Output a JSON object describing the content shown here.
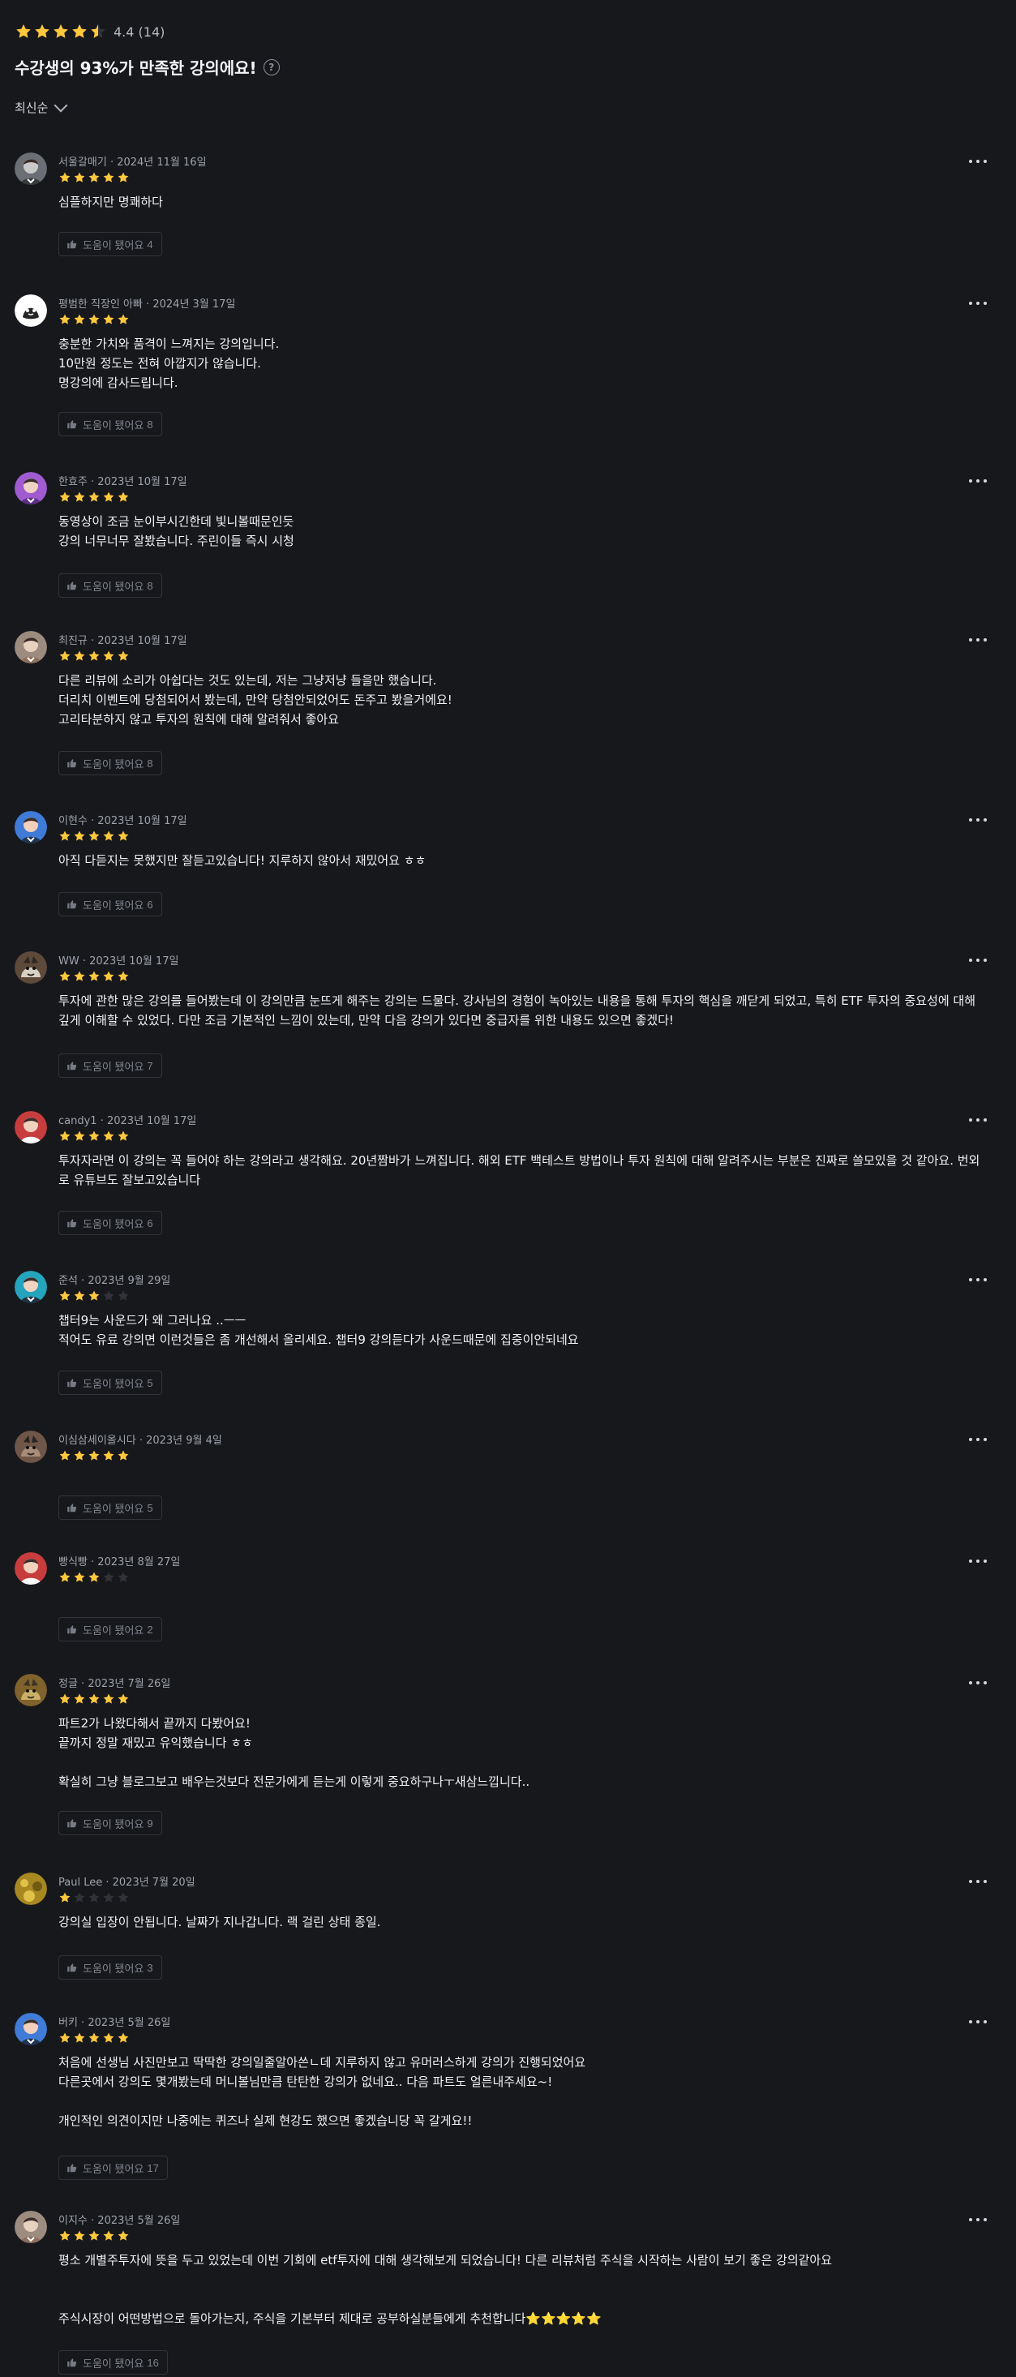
{
  "summary": {
    "rating": "4.4",
    "review_count": "(14)",
    "headline": "수강생의 93%가 만족한 강의에요!",
    "help_icon": "?",
    "stars": [
      1,
      1,
      1,
      1,
      0.5
    ]
  },
  "sort": {
    "label": "최신순",
    "icon": "chevron-down-icon"
  },
  "reviews": [
    {
      "author": "서울갈매기",
      "date": "2024년 11월 16일",
      "rating": 5,
      "body": "심플하지만 명쾌하다",
      "helpful_label": "도움이 됐어요",
      "helpful_count": "4",
      "avatar": "gray-portrait"
    },
    {
      "author": "평범한 직장인 아빠",
      "date": "2024년 3월 17일",
      "rating": 5,
      "body": "충분한 가치와 품격이 느껴지는 강의입니다.\n10만원 정도는 전혀 아깝지가 않습니다.\n명강의에 감사드립니다.",
      "helpful_label": "도움이 됐어요",
      "helpful_count": "8",
      "avatar": "white-cartoon"
    },
    {
      "author": "한효주",
      "date": "2023년 10월 17일",
      "rating": 5,
      "body": "동영상이 조금 눈이부시긴한데 빛니볼때문인듯\n강의 너무너무 잘봤습니다. 주린이들 즉시 시청",
      "helpful_label": "도움이 됐어요",
      "helpful_count": "8",
      "avatar": "purple-portrait"
    },
    {
      "author": "최진규",
      "date": "2023년 10월 17일",
      "rating": 5,
      "body": "다른 리뷰에 소리가 아쉽다는 것도 있는데, 저는 그냥저냥 들을만 했습니다.\n더리치 이벤트에 당첨되어서 봤는데, 만약 당첨안되었어도 돈주고 봤을거에요!\n고리타분하지 않고 투자의 원칙에 대해 알려줘서 좋아요",
      "helpful_label": "도움이 됐어요",
      "helpful_count": "8",
      "avatar": "tan-portrait"
    },
    {
      "author": "이현수",
      "date": "2023년 10월 17일",
      "rating": 5,
      "body": "아직 다듣지는 못했지만 잘듣고있습니다! 지루하지 않아서 재밌어요 ㅎㅎ",
      "helpful_label": "도움이 됐어요",
      "helpful_count": "6",
      "avatar": "blue-portrait"
    },
    {
      "author": "WW",
      "date": "2023년 10월 17일",
      "rating": 5,
      "body": "투자에 관한 많은 강의를 들어봤는데 이 강의만큼 눈뜨게 해주는 강의는 드물다. 강사님의 경험이 녹아있는 내용을 통해 투자의 핵심을 깨닫게 되었고, 특히 ETF 투자의 중요성에 대해 깊게 이해할 수 있었다. 다만 조금 기본적인 느낌이 있는데, 만약 다음 강의가 있다면 중급자를 위한 내용도 있으면 좋겠다!",
      "helpful_label": "도움이 됐어요",
      "helpful_count": "7",
      "avatar": "brown-animal"
    },
    {
      "author": "candy1",
      "date": "2023년 10월 17일",
      "rating": 5,
      "body": "투자자라면 이 강의는 꼭 들어야 하는 강의라고 생각해요. 20년짬바가 느껴집니다. 해외 ETF 백테스트 방법이나 투자 원칙에 대해 알려주시는 부분은 진짜로 쓸모있을 것 같아요. 번외로 유튜브도 잘보고있습니다",
      "helpful_label": "도움이 됐어요",
      "helpful_count": "6",
      "avatar": "red-portrait"
    },
    {
      "author": "준석",
      "date": "2023년 9월 29일",
      "rating": 3,
      "body": "챕터9는 사운드가 왜 그러나요 ..ㅡㅡ\n적어도 유료 강의면 이런것들은 좀 개선해서 올리세요. 챕터9 강의듣다가 사운드때문에 집중이안되네요",
      "helpful_label": "도움이 됐어요",
      "helpful_count": "5",
      "avatar": "teal-portrait"
    },
    {
      "author": "이심삼세이올시다",
      "date": "2023년 9월 4일",
      "rating": 5,
      "body": "",
      "helpful_label": "도움이 됐어요",
      "helpful_count": "5",
      "avatar": "dark-animal"
    },
    {
      "author": "빵식빵",
      "date": "2023년 8월 27일",
      "rating": 3,
      "body": "",
      "helpful_label": "도움이 됐어요",
      "helpful_count": "2",
      "avatar": "red-portrait"
    },
    {
      "author": "정글",
      "date": "2023년 7월 26일",
      "rating": 5,
      "body": "파트2가 나왔다해서 끝까지 다봤어요!\n끝까지 정말 재밌고 유익했습니다 ㅎㅎ\n\n확실히 그냥 블로그보고 배우는것보다 전문가에게 듣는게 이렇게 중요하구나ㅜ새삼느낍니다..",
      "helpful_label": "도움이 됐어요",
      "helpful_count": "9",
      "avatar": "olive-animal"
    },
    {
      "author": "Paul Lee",
      "date": "2023년 7월 20일",
      "rating": 1,
      "body": "강의실 입장이 안됩니다. 날짜가 지나갑니다. 랙 걸린 상태 종일.",
      "helpful_label": "도움이 됐어요",
      "helpful_count": "3",
      "avatar": "gold-texture"
    },
    {
      "author": "버키",
      "date": "2023년 5월 26일",
      "rating": 5,
      "body": "처음에 선생님 사진만보고 딱딱한 강의일줄알아쓴ㄴ데 지루하지 않고 유머러스하게 강의가 진행되었어요\n다른곳에서 강의도 몇개봤는데 머니볼님만큼 탄탄한 강의가 없네요.. 다음 파트도 얼른내주세요~!\n\n개인적인 의견이지만 나중에는 퀴즈나 실제 현강도 했으면 좋겠습니당 꼭 갈게요!!",
      "helpful_label": "도움이 됐어요",
      "helpful_count": "17",
      "avatar": "blue-portrait"
    },
    {
      "author": "이지수",
      "date": "2023년 5월 26일",
      "rating": 5,
      "body": "평소 개별주투자에 뜻을 두고 있었는데 이번 기회에 etf투자에 대해 생각해보게 되었습니다! 다른 리뷰처럼 주식을 시작하는 사람이 보기 좋은 강의같아요\n\n\n주식시장이 어떤방법으로 돌아가는지, 주식을 기본부터 제대로 공부하실분들에게 추천합니다⭐️⭐️⭐️⭐️⭐️",
      "helpful_label": "도움이 됐어요",
      "helpful_count": "16",
      "avatar": "tan-portrait"
    }
  ],
  "colors": {
    "star_filled": "#ffc83d",
    "star_empty": "#303238",
    "background": "#17181c"
  },
  "icons": {
    "more": "more-horizontal-icon",
    "helpful": "thumbs-up-icon",
    "star": "star-icon"
  }
}
